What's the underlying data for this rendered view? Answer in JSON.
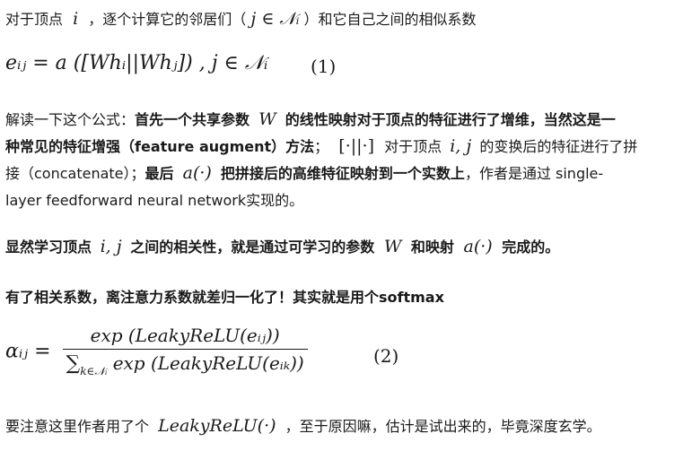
{
  "intro": {
    "text1": "对于顶点",
    "var_i": "i",
    "text2": "，逐个计算它的邻居们（",
    "neighbor_expr": "j ∈ 𝒩ᵢ",
    "text3": "）和它自己之间的相似系数"
  },
  "eq1": {
    "lhs": "eᵢⱼ = a",
    "body": "([Whᵢ||Whⱼ]) , j ∈ 𝒩ᵢ",
    "number": "(1)"
  },
  "para2": {
    "l1_a": "解读一下这个公式：",
    "l1_b": "首先一个共享参数",
    "l1_W": "W",
    "l1_c": "的线性映射对于顶点的特征进行了增维，当然这是一",
    "l2_a": "种常见的特征增强（feature augment）方法",
    "l2_b": "；",
    "l2_concat": "[·||·]",
    "l2_c": "对于顶点",
    "l2_ij": "i, j",
    "l2_d": "的变换后的特征进行了拼",
    "l3_a": "接（concatenate）；",
    "l3_b": "最后",
    "l3_a_fn": "a(·)",
    "l3_c": "把拼接后的高维特征映射到一个实数上",
    "l3_d": "，作者是通过 single-",
    "l4": "layer feedforward neural network实现的。"
  },
  "para3": {
    "a": "显然学习顶点",
    "ij": "i, j",
    "b": "之间的相关性，就是通过可学习的参数",
    "W": "W",
    "c": "和映射",
    "a_fn": "a(·)",
    "d": "完成的。"
  },
  "para4": {
    "text": "有了相关系数，离注意力系数就差归一化了！其实就是用个softmax"
  },
  "eq2": {
    "lhs": "αᵢⱼ =",
    "numerator": "exp (LeakyReLU(eᵢⱼ))",
    "denominator_sum": "∑",
    "denominator_sub": "k∈𝒩ᵢ",
    "denominator_rest": "exp (LeakyReLU(eᵢₖ))",
    "number": "(2)"
  },
  "para5": {
    "a": "要注意这里作者用了个",
    "fn": "LeakyReLU(·)",
    "b": "，至于原因嘛，估计是试出来的，毕竟深度玄学。"
  }
}
